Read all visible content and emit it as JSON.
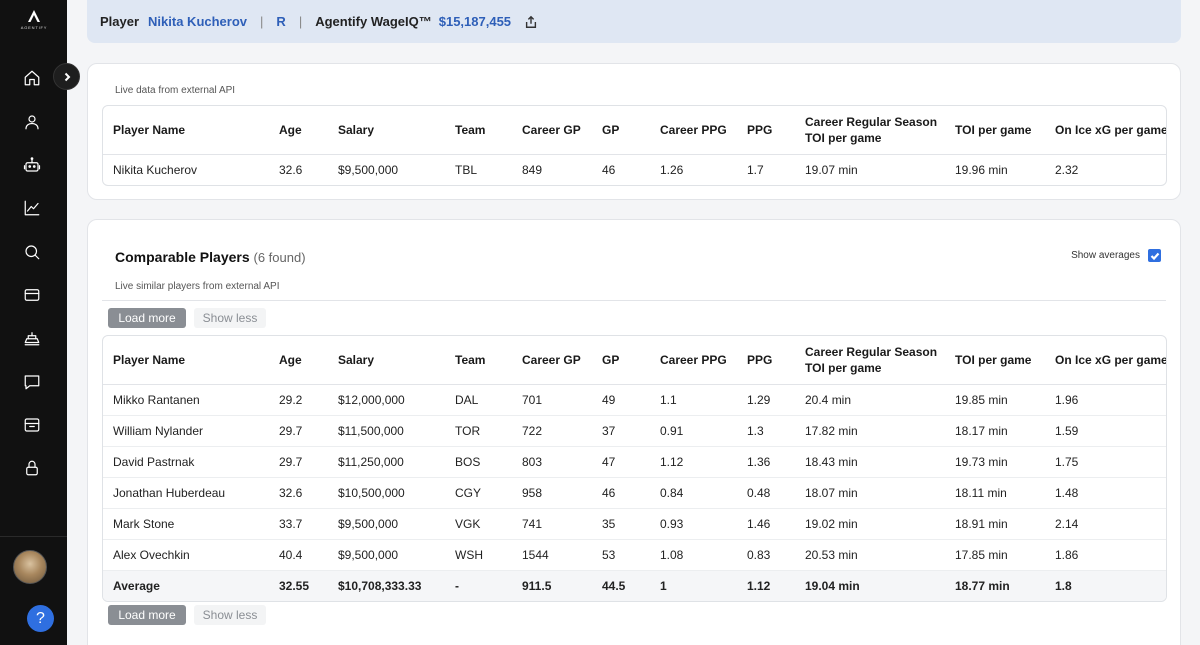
{
  "brand": {
    "logo_text": "AGENTIFY"
  },
  "header": {
    "player_label": "Player",
    "player_name": "Nikita Kucherov",
    "position": "R",
    "wageiq_label": "Agentify WageIQ™",
    "wageiq_value": "$15,187,455"
  },
  "columns": [
    "Player Name",
    "Age",
    "Salary",
    "Team",
    "Career GP",
    "GP",
    "Career PPG",
    "PPG",
    "Career Regular Season TOI per game",
    "TOI per game",
    "On Ice xG per game"
  ],
  "player_card": {
    "caption": "Live data from external API",
    "rows": [
      [
        "Nikita Kucherov",
        "32.6",
        "$9,500,000",
        "TBL",
        "849",
        "46",
        "1.26",
        "1.7",
        "19.07 min",
        "19.96 min",
        "2.32"
      ]
    ]
  },
  "comparables": {
    "title": "Comparable Players",
    "found": "(6 found)",
    "caption": "Live similar players from external API",
    "show_averages_label": "Show averages",
    "show_averages_checked": true,
    "load_more_label": "Load more",
    "show_less_label": "Show less",
    "rows": [
      [
        "Mikko Rantanen",
        "29.2",
        "$12,000,000",
        "DAL",
        "701",
        "49",
        "1.1",
        "1.29",
        "20.4 min",
        "19.85 min",
        "1.96"
      ],
      [
        "William Nylander",
        "29.7",
        "$11,500,000",
        "TOR",
        "722",
        "37",
        "0.91",
        "1.3",
        "17.82 min",
        "18.17 min",
        "1.59"
      ],
      [
        "David Pastrnak",
        "29.7",
        "$11,250,000",
        "BOS",
        "803",
        "47",
        "1.12",
        "1.36",
        "18.43 min",
        "19.73 min",
        "1.75"
      ],
      [
        "Jonathan Huberdeau",
        "32.6",
        "$10,500,000",
        "CGY",
        "958",
        "46",
        "0.84",
        "0.48",
        "18.07 min",
        "18.11 min",
        "1.48"
      ],
      [
        "Mark Stone",
        "33.7",
        "$9,500,000",
        "VGK",
        "741",
        "35",
        "0.93",
        "1.46",
        "19.02 min",
        "18.91 min",
        "2.14"
      ],
      [
        "Alex Ovechkin",
        "40.4",
        "$9,500,000",
        "WSH",
        "1544",
        "53",
        "1.08",
        "0.83",
        "20.53 min",
        "17.85 min",
        "1.86"
      ]
    ],
    "average": [
      "Average",
      "32.55",
      "$10,708,333.33",
      "-",
      "911.5",
      "44.5",
      "1",
      "1.12",
      "19.04 min",
      "18.77 min",
      "1.8"
    ]
  },
  "sidebar": {
    "items": [
      "home-icon",
      "user-icon",
      "robot-icon",
      "chart-line-icon",
      "search-icon",
      "credit-card-icon",
      "ship-icon",
      "chat-icon",
      "inbox-icon",
      "lock-icon"
    ]
  },
  "colors": {
    "accent": "#2e5fb8",
    "sidebar_bg": "#111111",
    "header_bg": "#dfe7f3",
    "button_gray": "#8a8e94",
    "checkbox": "#2f6fe0"
  }
}
